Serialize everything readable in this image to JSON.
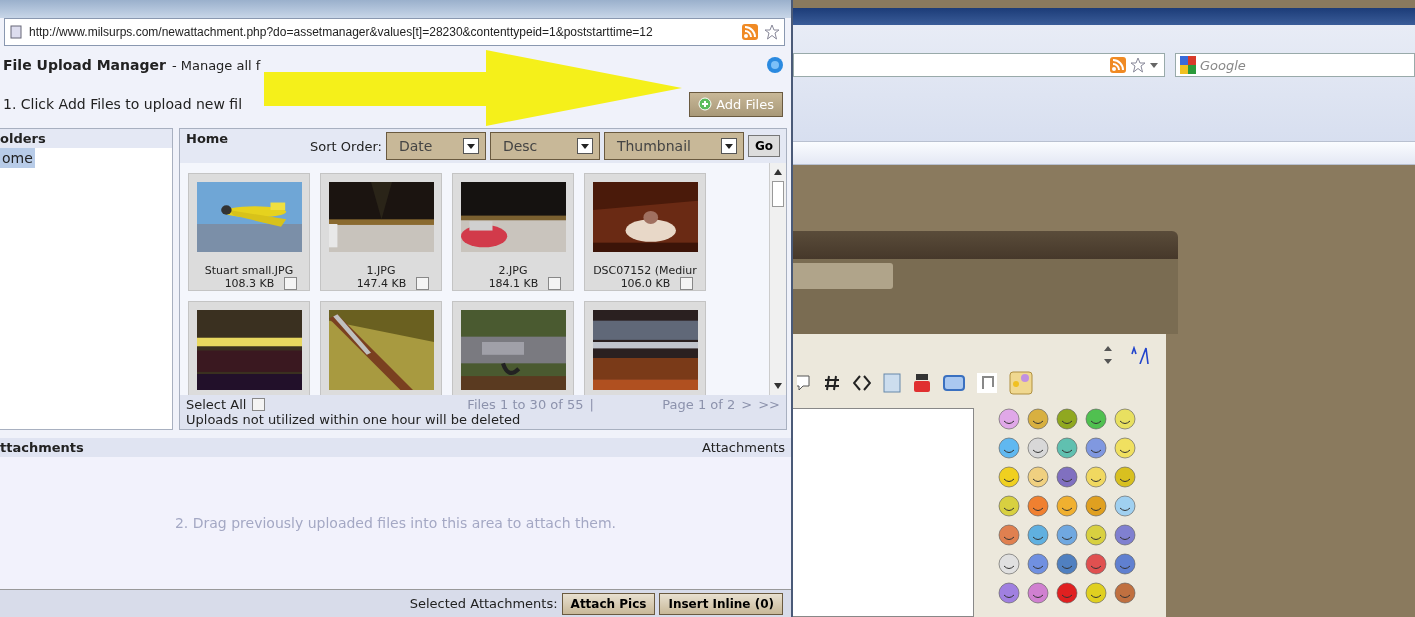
{
  "popup": {
    "url": "http://www.milsurps.com/newattachment.php?do=assetmanager&values[t]=28230&contenttypeid=1&poststarttime=12",
    "heading": "File Upload Manager",
    "subheading": "- Manage all f",
    "instruction": "1. Click Add Files to upload new fil",
    "add_button": "Add Files"
  },
  "folders": {
    "title": "olders",
    "items": [
      {
        "label": "ome",
        "selected": true
      }
    ]
  },
  "home": {
    "title": "Home",
    "sort_label": "Sort Order:",
    "selects": [
      "Date",
      "Desc",
      "Thumbnail"
    ],
    "go": "Go"
  },
  "files": [
    {
      "name": "Stuart small.JPG",
      "size": "108.3 KB",
      "checked": false,
      "kind": "picture"
    },
    {
      "name": "1.JPG",
      "size": "147.4 KB",
      "checked": false,
      "kind": "picture"
    },
    {
      "name": "2.JPG",
      "size": "184.1 KB",
      "checked": false,
      "kind": "picture"
    },
    {
      "name": "DSC07152 (Mediur",
      "size": "106.0 KB",
      "checked": false,
      "kind": "picture"
    },
    {
      "kind": "picture"
    },
    {
      "kind": "picture"
    },
    {
      "kind": "picture"
    },
    {
      "kind": "picture"
    }
  ],
  "footer": {
    "select_all": "Select All",
    "select_all_checked": false,
    "count": "Files 1 to 30 of 55",
    "separator": "|",
    "page": "Page 1 of 2",
    "next": ">",
    "last": ">>",
    "notice": "Uploads not utilized within one hour will be deleted"
  },
  "attachments": {
    "title": "ttachments",
    "right_title": "Attachments",
    "drop_hint": "2. Drag previously uploaded files into this area to attach them.",
    "selected_label": "Selected Attachments:",
    "buttons": [
      "Attach Pics",
      "Insert Inline (0)"
    ]
  },
  "browser": {
    "search_placeholder": "Google"
  }
}
